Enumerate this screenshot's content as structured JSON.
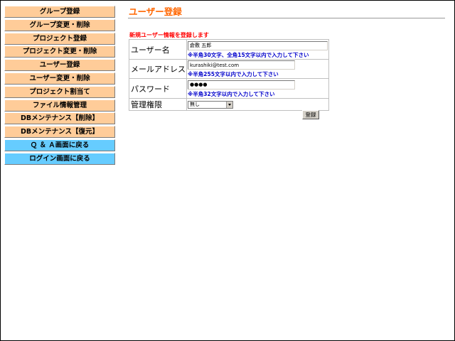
{
  "sidebar": {
    "items": [
      {
        "label": "グループ登録"
      },
      {
        "label": "グループ変更・削除"
      },
      {
        "label": "プロジェクト登録"
      },
      {
        "label": "プロジェクト変更・削除"
      },
      {
        "label": "ユーザー登録"
      },
      {
        "label": "ユーザー変更・削除"
      },
      {
        "label": "プロジェクト割当て"
      },
      {
        "label": "ファイル情報管理"
      },
      {
        "label": "DBメンテナンス【削除】"
      },
      {
        "label": "DBメンテナンス【復元】"
      },
      {
        "label": "Ｑ ＆ Ａ画面に戻る"
      },
      {
        "label": "ログイン画面に戻る"
      }
    ]
  },
  "colors": {
    "nav_default": "#ffcc99",
    "nav_return": "#66ccff",
    "title": "#ff6600",
    "notice": "#ff0000",
    "hint": "#0000cc"
  },
  "main": {
    "title": "ユーザー登録",
    "notice": "新規ユーザー情報を登録します",
    "form": {
      "username": {
        "label": "ユーザー名",
        "value": "倉敷 五郎",
        "hint": "※半角30文字、全角15文字以内で入力して下さい"
      },
      "email": {
        "label": "メールアドレス",
        "value": "kurashiki@test.com",
        "hint": "※半角255文字以内で入力して下さい"
      },
      "password": {
        "label": "パスワード",
        "value": "●●●●",
        "hint": "※半角32文字以内で入力して下さい"
      },
      "role": {
        "label": "管理権限",
        "selected": "無し"
      }
    },
    "submit_label": "登録"
  }
}
